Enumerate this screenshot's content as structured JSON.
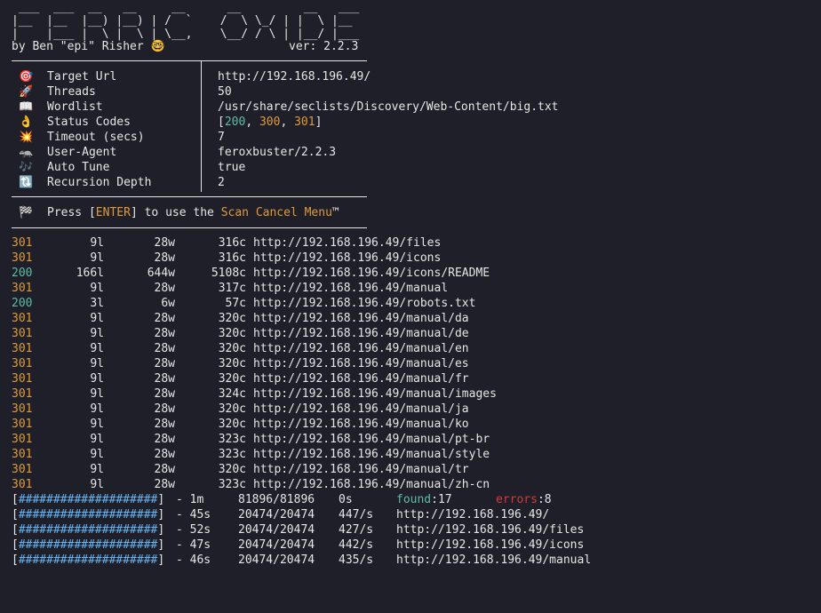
{
  "banner": {
    "art": [
      " ___  ___  __   __     __      __         __   ___",
      "|__  |__  |__) |__) | /  `    /  \\ \\_/ | |  \\ |__",
      "|    |___ |  \\ |  \\ | \\__,    \\__/ / \\ | |__/ |___"
    ],
    "author": "by Ben \"epi\" Risher 🤓",
    "version": "ver: 2.2.3"
  },
  "config": [
    {
      "icon": "target-icon",
      "glyph": "🎯",
      "label": "Target Url",
      "value": "http://192.168.196.49/"
    },
    {
      "icon": "threads-icon",
      "glyph": "🚀",
      "label": "Threads",
      "value": "50"
    },
    {
      "icon": "wordlist-icon",
      "glyph": "📖",
      "label": "Wordlist",
      "value": "/usr/share/seclists/Discovery/Web-Content/big.txt"
    },
    {
      "icon": "status-codes-icon",
      "glyph": "👌",
      "label": "Status Codes",
      "value_status": true,
      "value_open": "[",
      "codes": [
        "200",
        "300",
        "301"
      ],
      "value_close": "]"
    },
    {
      "icon": "timeout-icon",
      "glyph": "💥",
      "label": "Timeout (secs)",
      "value": "7"
    },
    {
      "icon": "user-agent-icon",
      "glyph": "🦡",
      "label": "User-Agent",
      "value": "feroxbuster/2.2.3"
    },
    {
      "icon": "auto-tune-icon",
      "glyph": "🎶",
      "label": "Auto Tune",
      "value": "true"
    },
    {
      "icon": "recursion-icon",
      "glyph": "🔃",
      "label": "Recursion Depth",
      "value": "2"
    }
  ],
  "prompt": {
    "icon_glyph": "🏁",
    "pre": "Press [",
    "key": "ENTER",
    "mid": "] to use the ",
    "menu": "Scan Cancel Menu",
    "tm": "™"
  },
  "results": [
    {
      "status": "301",
      "lines": "9l",
      "words": "28w",
      "chars": "316c",
      "url": "http://192.168.196.49/files"
    },
    {
      "status": "301",
      "lines": "9l",
      "words": "28w",
      "chars": "316c",
      "url": "http://192.168.196.49/icons"
    },
    {
      "status": "200",
      "lines": "166l",
      "words": "644w",
      "chars": "5108c",
      "url": "http://192.168.196.49/icons/README"
    },
    {
      "status": "301",
      "lines": "9l",
      "words": "28w",
      "chars": "317c",
      "url": "http://192.168.196.49/manual"
    },
    {
      "status": "200",
      "lines": "3l",
      "words": "6w",
      "chars": "57c",
      "url": "http://192.168.196.49/robots.txt"
    },
    {
      "status": "301",
      "lines": "9l",
      "words": "28w",
      "chars": "320c",
      "url": "http://192.168.196.49/manual/da"
    },
    {
      "status": "301",
      "lines": "9l",
      "words": "28w",
      "chars": "320c",
      "url": "http://192.168.196.49/manual/de"
    },
    {
      "status": "301",
      "lines": "9l",
      "words": "28w",
      "chars": "320c",
      "url": "http://192.168.196.49/manual/en"
    },
    {
      "status": "301",
      "lines": "9l",
      "words": "28w",
      "chars": "320c",
      "url": "http://192.168.196.49/manual/es"
    },
    {
      "status": "301",
      "lines": "9l",
      "words": "28w",
      "chars": "320c",
      "url": "http://192.168.196.49/manual/fr"
    },
    {
      "status": "301",
      "lines": "9l",
      "words": "28w",
      "chars": "324c",
      "url": "http://192.168.196.49/manual/images"
    },
    {
      "status": "301",
      "lines": "9l",
      "words": "28w",
      "chars": "320c",
      "url": "http://192.168.196.49/manual/ja"
    },
    {
      "status": "301",
      "lines": "9l",
      "words": "28w",
      "chars": "320c",
      "url": "http://192.168.196.49/manual/ko"
    },
    {
      "status": "301",
      "lines": "9l",
      "words": "28w",
      "chars": "323c",
      "url": "http://192.168.196.49/manual/pt-br"
    },
    {
      "status": "301",
      "lines": "9l",
      "words": "28w",
      "chars": "323c",
      "url": "http://192.168.196.49/manual/style"
    },
    {
      "status": "301",
      "lines": "9l",
      "words": "28w",
      "chars": "320c",
      "url": "http://192.168.196.49/manual/tr"
    },
    {
      "status": "301",
      "lines": "9l",
      "words": "28w",
      "chars": "323c",
      "url": "http://192.168.196.49/manual/zh-cn"
    }
  ],
  "progress_summary": {
    "bar": "[####################]",
    "elapsed": "- 1m",
    "count": "81896/81896",
    "eta": "0s",
    "found_label": "found",
    "found_value": ":17",
    "errors_label": "errors",
    "errors_value": ":8"
  },
  "progress_dirs": [
    {
      "bar": "[####################]",
      "elapsed": "- 45s",
      "count": "20474/20474",
      "rate": "447/s",
      "url": "http://192.168.196.49/"
    },
    {
      "bar": "[####################]",
      "elapsed": "- 52s",
      "count": "20474/20474",
      "rate": "427/s",
      "url": "http://192.168.196.49/files"
    },
    {
      "bar": "[####################]",
      "elapsed": "- 47s",
      "count": "20474/20474",
      "rate": "442/s",
      "url": "http://192.168.196.49/icons"
    },
    {
      "bar": "[####################]",
      "elapsed": "- 46s",
      "count": "20474/20474",
      "rate": "435/s",
      "url": "http://192.168.196.49/manual"
    }
  ],
  "colors": {
    "background": "#1e1f29",
    "foreground": "#e6e6e6",
    "accent_orange": "#e09a3a",
    "accent_green": "#5bbfa3",
    "accent_cyan": "#64b5f6",
    "error_red": "#d23c3c"
  }
}
